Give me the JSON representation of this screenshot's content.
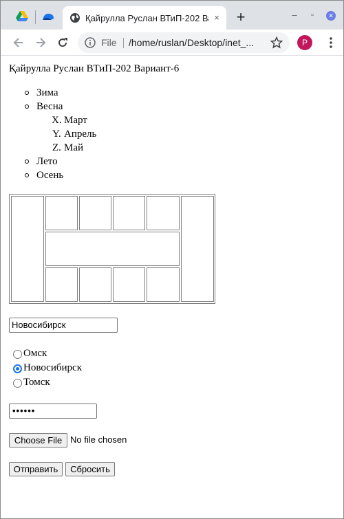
{
  "browser": {
    "active_tab_title": "Қайрулла Руслан ВТиП-202 Вариант-6",
    "close_tab_glyph": "×",
    "new_tab_glyph": "+",
    "url_scheme": "File",
    "url": "/home/ruslan/Desktop/inet_...",
    "profile_initial": "P",
    "profile_color": "#c2185b",
    "window_controls": {
      "minimize": "–",
      "restore": "▫",
      "close": "✕"
    }
  },
  "page": {
    "heading": "Қайрулла Руслан ВТиП-202 Вариант-6",
    "list": [
      {
        "label": "Зима"
      },
      {
        "label": "Весна",
        "children": [
          {
            "marker": "X.",
            "label": "Март"
          },
          {
            "marker": "Y.",
            "label": "Апрель"
          },
          {
            "marker": "Z.",
            "label": "Май"
          }
        ]
      },
      {
        "label": "Лето"
      },
      {
        "label": "Осень"
      }
    ],
    "city_input_value": "Новосибирск",
    "radios": [
      {
        "label": "Омск",
        "checked": false
      },
      {
        "label": "Новосибирск",
        "checked": true
      },
      {
        "label": "Томск",
        "checked": false
      }
    ],
    "password_mask": "••••••",
    "choose_file_label": "Choose File",
    "file_status": "No file chosen",
    "submit_label": "Отправить",
    "reset_label": "Сбросить"
  }
}
